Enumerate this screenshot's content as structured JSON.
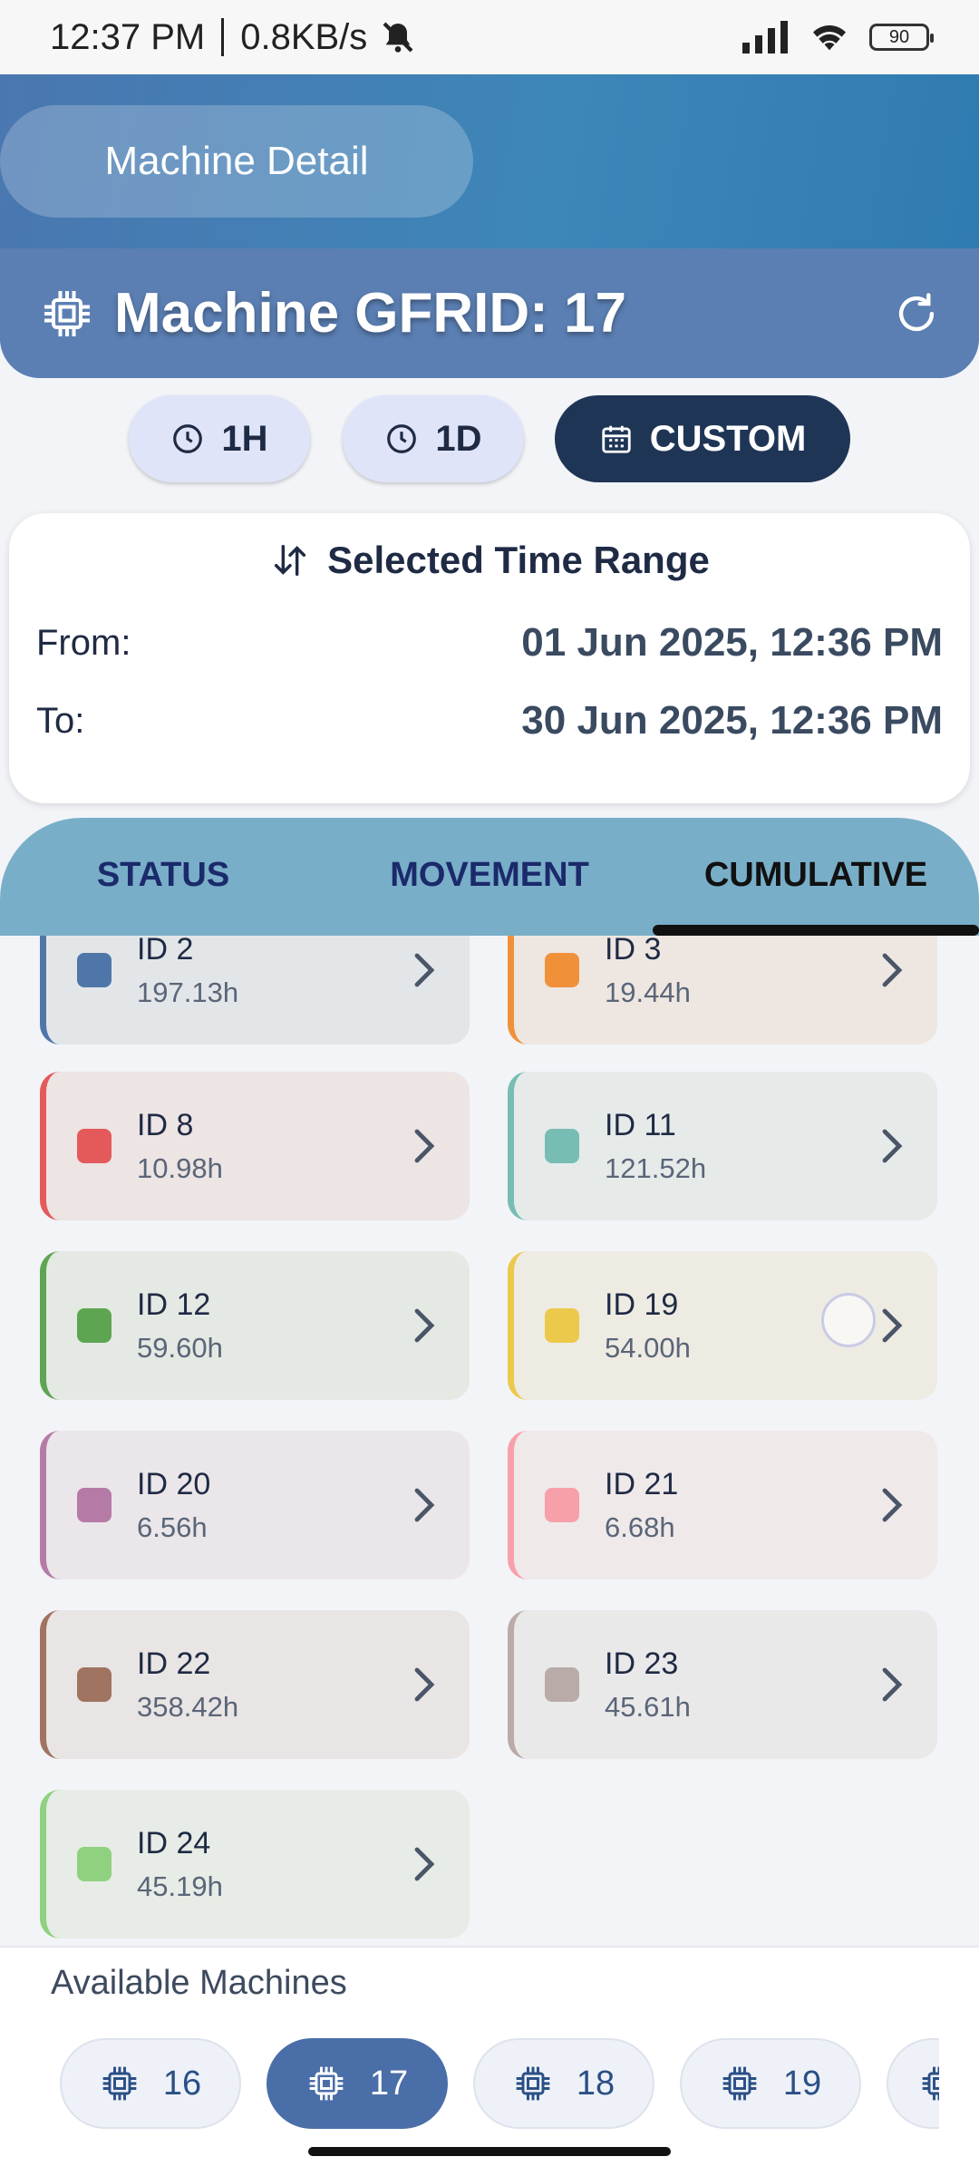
{
  "status_bar": {
    "time": "12:37 PM",
    "speed": "0.8KB/s",
    "battery": "90"
  },
  "header": {
    "title": "Machine Detail",
    "machine_title": "Machine GFRID: 17"
  },
  "range_buttons": [
    {
      "label": "1H"
    },
    {
      "label": "1D"
    },
    {
      "label": "CUSTOM"
    }
  ],
  "time_range": {
    "title": "Selected Time Range",
    "from_label": "From:",
    "from_value": "01 Jun 2025, 12:36 PM",
    "to_label": "To:",
    "to_value": "30 Jun 2025, 12:36 PM"
  },
  "tabs": [
    {
      "label": "STATUS"
    },
    {
      "label": "MOVEMENT"
    },
    {
      "label": "CUMULATIVE"
    }
  ],
  "cards": [
    {
      "id": "ID 2",
      "hours": "197.13h",
      "color": "#4f76a8"
    },
    {
      "id": "ID 3",
      "hours": "19.44h",
      "color": "#f0913a"
    },
    {
      "id": "ID 8",
      "hours": "10.98h",
      "color": "#e45a5a"
    },
    {
      "id": "ID 11",
      "hours": "121.52h",
      "color": "#78bdb3"
    },
    {
      "id": "ID 12",
      "hours": "59.60h",
      "color": "#5ea552"
    },
    {
      "id": "ID 19",
      "hours": "54.00h",
      "color": "#ecc94b"
    },
    {
      "id": "ID 20",
      "hours": "6.56h",
      "color": "#b57ba6"
    },
    {
      "id": "ID 21",
      "hours": "6.68h",
      "color": "#f7a0aa"
    },
    {
      "id": "ID 22",
      "hours": "358.42h",
      "color": "#a07461"
    },
    {
      "id": "ID 23",
      "hours": "45.61h",
      "color": "#b9aba8"
    },
    {
      "id": "ID 24",
      "hours": "45.19h",
      "color": "#8fd17e"
    }
  ],
  "available": {
    "label": "Available Machines",
    "machines": [
      "16",
      "17",
      "18",
      "19"
    ],
    "selected": "17"
  }
}
